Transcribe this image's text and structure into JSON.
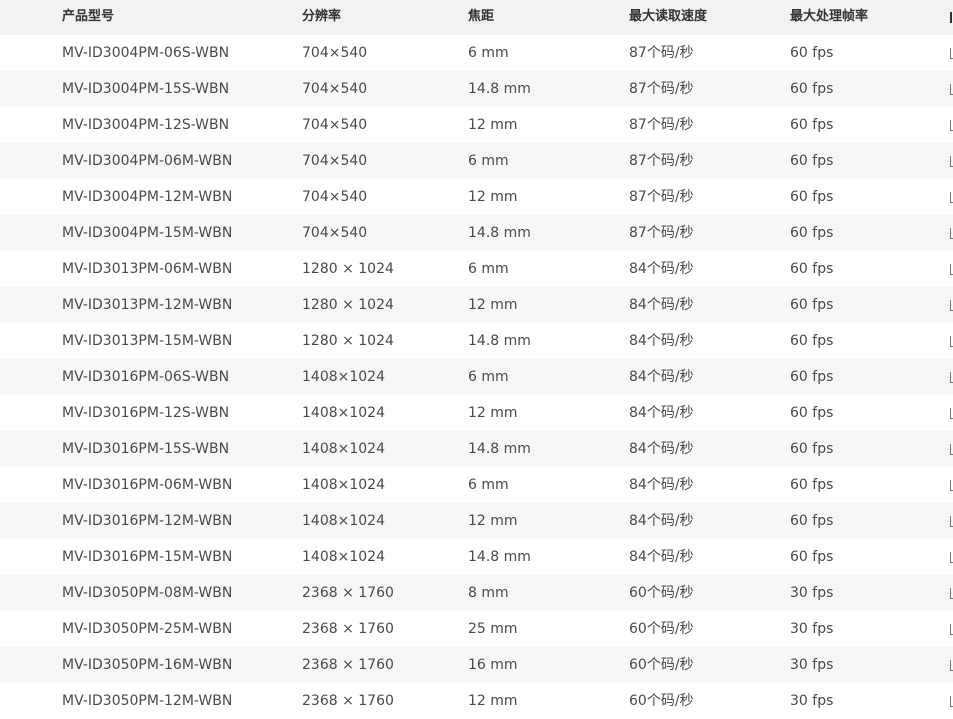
{
  "table": {
    "headers": {
      "model": "产品型号",
      "resolution": "分辨率",
      "focal": "焦距",
      "speed": "最大读取速度",
      "fps": "最大处理帧率"
    },
    "rows": [
      {
        "model": "MV-ID3004PM-06S-WBN",
        "resolution": "704×540",
        "focal": "6 mm",
        "speed": "87个码/秒",
        "fps": "60 fps"
      },
      {
        "model": "MV-ID3004PM-15S-WBN",
        "resolution": "704×540",
        "focal": "14.8 mm",
        "speed": "87个码/秒",
        "fps": "60 fps"
      },
      {
        "model": "MV-ID3004PM-12S-WBN",
        "resolution": "704×540",
        "focal": "12 mm",
        "speed": "87个码/秒",
        "fps": "60 fps"
      },
      {
        "model": "MV-ID3004PM-06M-WBN",
        "resolution": "704×540",
        "focal": "6 mm",
        "speed": "87个码/秒",
        "fps": "60 fps"
      },
      {
        "model": "MV-ID3004PM-12M-WBN",
        "resolution": "704×540",
        "focal": "12 mm",
        "speed": "87个码/秒",
        "fps": "60 fps"
      },
      {
        "model": "MV-ID3004PM-15M-WBN",
        "resolution": "704×540",
        "focal": "14.8 mm",
        "speed": "87个码/秒",
        "fps": "60 fps"
      },
      {
        "model": "MV-ID3013PM-06M-WBN",
        "resolution": "1280 × 1024",
        "focal": "6 mm",
        "speed": "84个码/秒",
        "fps": "60 fps"
      },
      {
        "model": "MV-ID3013PM-12M-WBN",
        "resolution": "1280 × 1024",
        "focal": "12 mm",
        "speed": "84个码/秒",
        "fps": "60 fps"
      },
      {
        "model": "MV-ID3013PM-15M-WBN",
        "resolution": "1280 × 1024",
        "focal": "14.8 mm",
        "speed": "84个码/秒",
        "fps": "60 fps"
      },
      {
        "model": "MV-ID3016PM-06S-WBN",
        "resolution": "1408×1024",
        "focal": "6 mm",
        "speed": "84个码/秒",
        "fps": "60 fps"
      },
      {
        "model": "MV-ID3016PM-12S-WBN",
        "resolution": "1408×1024",
        "focal": "12 mm",
        "speed": "84个码/秒",
        "fps": "60 fps"
      },
      {
        "model": "MV-ID3016PM-15S-WBN",
        "resolution": "1408×1024",
        "focal": "14.8 mm",
        "speed": "84个码/秒",
        "fps": "60 fps"
      },
      {
        "model": "MV-ID3016PM-06M-WBN",
        "resolution": "1408×1024",
        "focal": "6 mm",
        "speed": "84个码/秒",
        "fps": "60 fps"
      },
      {
        "model": "MV-ID3016PM-12M-WBN",
        "resolution": "1408×1024",
        "focal": "12 mm",
        "speed": "84个码/秒",
        "fps": "60 fps"
      },
      {
        "model": "MV-ID3016PM-15M-WBN",
        "resolution": "1408×1024",
        "focal": "14.8 mm",
        "speed": "84个码/秒",
        "fps": "60 fps"
      },
      {
        "model": "MV-ID3050PM-08M-WBN",
        "resolution": "2368 × 1760",
        "focal": "8 mm",
        "speed": "60个码/秒",
        "fps": "30 fps"
      },
      {
        "model": "MV-ID3050PM-25M-WBN",
        "resolution": "2368 × 1760",
        "focal": "25 mm",
        "speed": "60个码/秒",
        "fps": "30 fps"
      },
      {
        "model": "MV-ID3050PM-16M-WBN",
        "resolution": "2368 × 1760",
        "focal": "16 mm",
        "speed": "60个码/秒",
        "fps": "30 fps"
      },
      {
        "model": "MV-ID3050PM-12M-WBN",
        "resolution": "2368 × 1760",
        "focal": "12 mm",
        "speed": "60个码/秒",
        "fps": "30 fps"
      }
    ]
  }
}
